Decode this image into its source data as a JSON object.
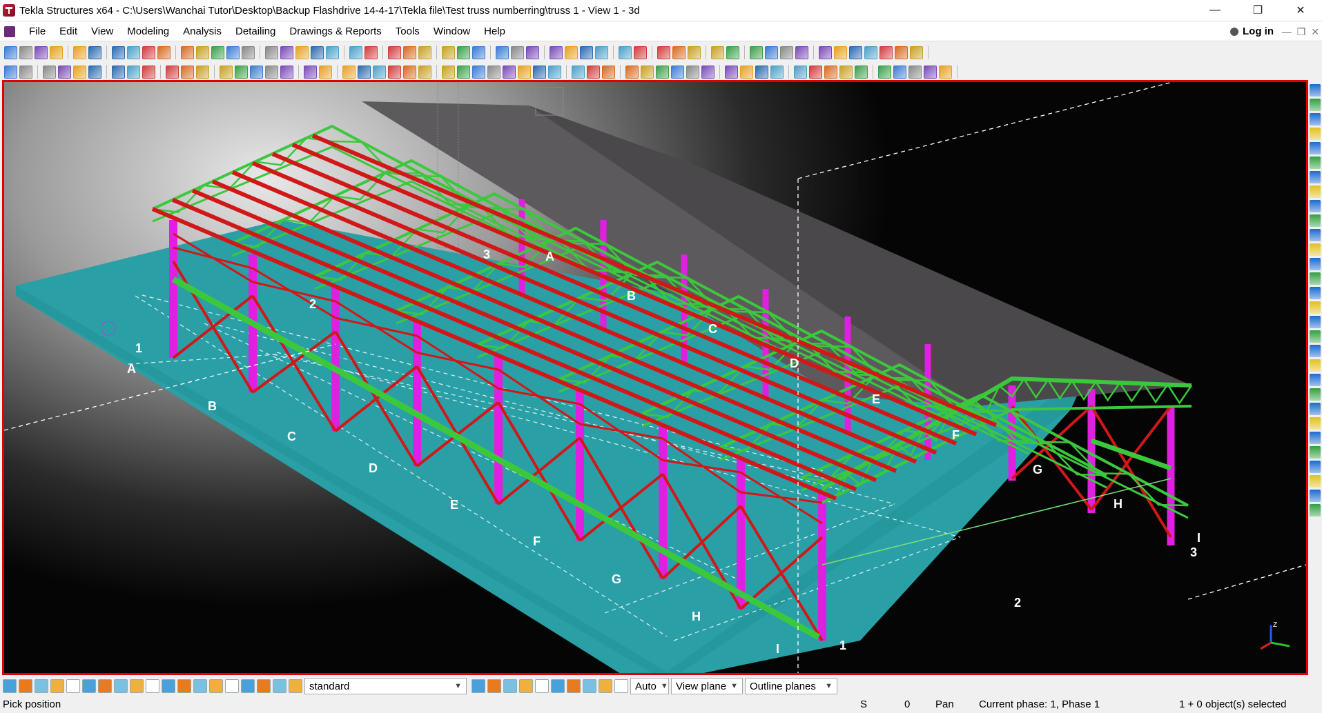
{
  "window": {
    "title": "Tekla Structures x64 - C:\\Users\\Wanchai Tutor\\Desktop\\Backup Flashdrive 14-4-17\\Tekla file\\Test truss numberring\\truss 1  - View 1 - 3d",
    "minimize": "—",
    "restore": "❐",
    "close": "✕"
  },
  "menu": {
    "items": [
      "File",
      "Edit",
      "View",
      "Modeling",
      "Analysis",
      "Detailing",
      "Drawings & Reports",
      "Tools",
      "Window",
      "Help"
    ],
    "login": "Log in",
    "mdi_min": "—",
    "mdi_restore": "❐",
    "mdi_close": "✕"
  },
  "bottom_toolbar": {
    "selection_filter": "standard",
    "snap_mode": "Auto",
    "view_plane": "View plane",
    "outline_planes": "Outline planes"
  },
  "statusbar": {
    "prompt": "Pick position",
    "s_label": "S",
    "s_value": "0",
    "mode": "Pan",
    "phase": "Current phase: 1, Phase 1",
    "selection": "1 + 0 object(s) selected"
  },
  "model_grid": {
    "row_labels_near": [
      "A",
      "B",
      "C",
      "D",
      "E",
      "F",
      "G",
      "H",
      "I"
    ],
    "row_labels_far": [
      "A",
      "B",
      "C",
      "D",
      "E",
      "F",
      "G",
      "H",
      "I"
    ],
    "column_labels_left": [
      "1",
      "2",
      "3"
    ],
    "column_labels_front": [
      "1",
      "2",
      "3"
    ]
  },
  "colors": {
    "column": "#e020e0",
    "purlin": "#d01818",
    "truss": "#3cc83c",
    "ground": "#2aa0a6",
    "roof": "#5a5a5a",
    "viewport_border": "#e00000",
    "axis_z": "#2060ff",
    "axis_y": "#30c030"
  },
  "icons": {
    "app": "tekla-logo-icon",
    "user": "user-icon",
    "axis_triad": "coordinate-axis-icon"
  }
}
